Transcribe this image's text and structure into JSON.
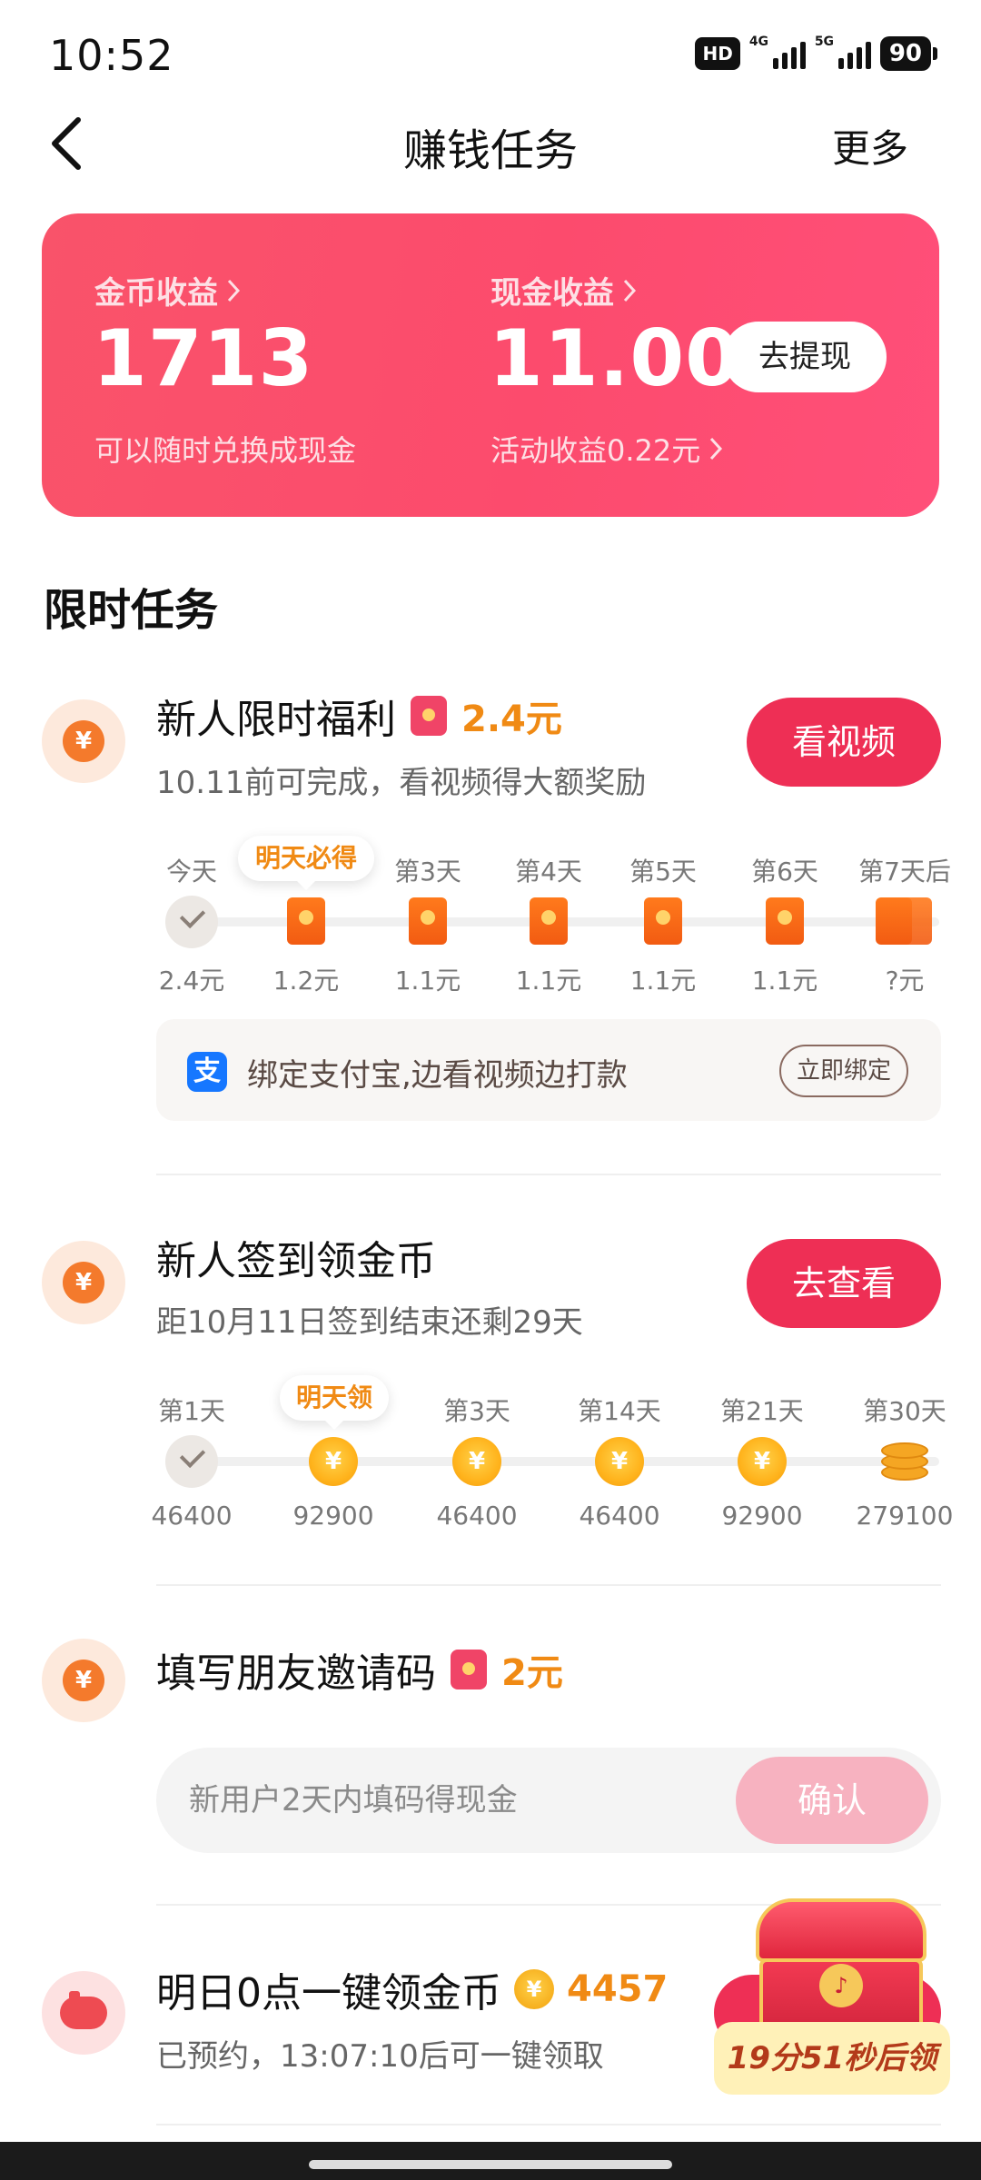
{
  "status_bar": {
    "time": "10:52",
    "hd": "HD",
    "net1": "4G",
    "net2": "5G",
    "battery": "90"
  },
  "header": {
    "title": "赚钱任务",
    "more": "更多"
  },
  "earnings": {
    "coin_label": "金币收益",
    "coin_value": "1713",
    "coin_sub": "可以随时兑换成现金",
    "cash_label": "现金收益",
    "cash_value": "11.00",
    "cash_sub": "活动收益0.22元",
    "withdraw_button": "去提现"
  },
  "section_title": "限时任务",
  "tasks": {
    "newbie": {
      "title": "新人限时福利",
      "reward": "2.4元",
      "subtitle": "10.11前可完成，看视频得大额奖励",
      "button": "看视频",
      "bubble": "明天必得",
      "days": [
        "今天",
        "明天必得",
        "第3天",
        "第4天",
        "第5天",
        "第6天",
        "第7天后"
      ],
      "values": [
        "2.4元",
        "1.2元",
        "1.1元",
        "1.1元",
        "1.1元",
        "1.1元",
        "?元"
      ],
      "alipay": {
        "logo": "支",
        "text": "绑定支付宝,边看视频边打款",
        "button": "立即绑定"
      }
    },
    "signin": {
      "title": "新人签到领金币",
      "subtitle": "距10月11日签到结束还剩29天",
      "button": "去查看",
      "bubble": "明天领",
      "days": [
        "第1天",
        "明天领",
        "第3天",
        "第14天",
        "第21天",
        "第30天"
      ],
      "values": [
        "46400",
        "92900",
        "46400",
        "46400",
        "92900",
        "279100"
      ]
    },
    "invite": {
      "title": "填写朋友邀请码",
      "reward": "2元",
      "placeholder": "新用户2天内填码得现金",
      "button": "确认"
    },
    "tomorrow": {
      "title": "明日0点一键领金币",
      "reward": "4457",
      "subtitle": "已预约，13:07:10后可一键领取",
      "countdown": "19分51秒后领"
    }
  },
  "icons": {
    "coin_symbol": "¥",
    "chest_symbol": "♪"
  },
  "colors": {
    "brand_red": "#ee2f55",
    "reward_orange": "#f08a14",
    "card_gradient_start": "#f9536a",
    "card_gradient_end": "#ff4f79"
  }
}
